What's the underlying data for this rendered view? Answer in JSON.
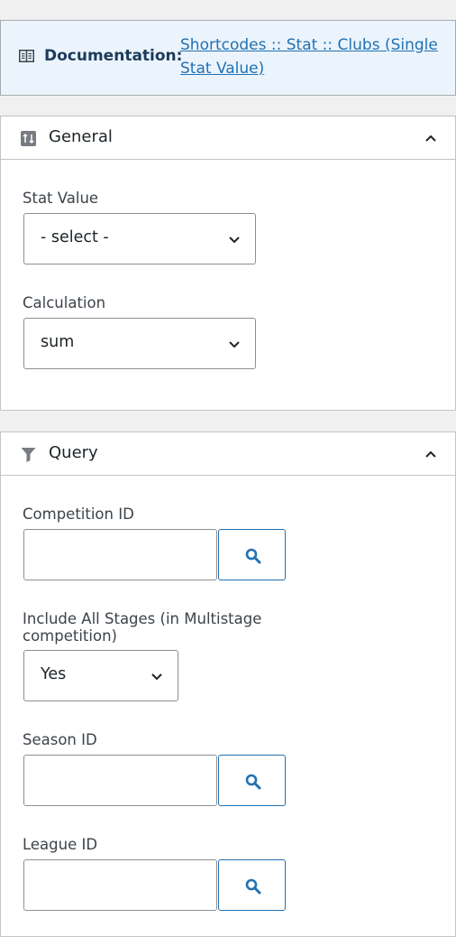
{
  "documentation": {
    "label": "Documentation:",
    "link_text": "Shortcodes :: Stat :: Clubs (Single Stat Value)"
  },
  "general": {
    "title": "General",
    "stat_value": {
      "label": "Stat Value",
      "value": "- select -"
    },
    "calculation": {
      "label": "Calculation",
      "value": "sum"
    }
  },
  "query": {
    "title": "Query",
    "competition_id": {
      "label": "Competition ID",
      "value": ""
    },
    "include_all_stages": {
      "label": "Include All Stages (in Multistage competition)",
      "value": "Yes"
    },
    "season_id": {
      "label": "Season ID",
      "value": ""
    },
    "league_id": {
      "label": "League ID",
      "value": ""
    }
  },
  "colors": {
    "accent": "#2271b1",
    "doc_bg": "#ebf4fd",
    "page_bg": "#f0f0f1"
  }
}
